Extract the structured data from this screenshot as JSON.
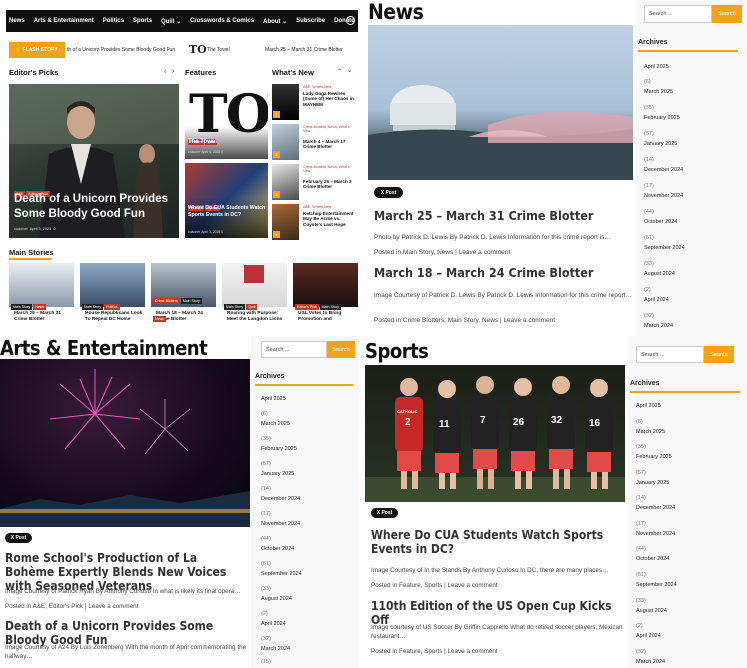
{
  "home": {
    "nav": [
      "News",
      "Arts & Entertainment",
      "Politics",
      "Sports",
      "Quill ⌄",
      "Crosswords & Comics",
      "About ⌄",
      "Subscribe",
      "Donate"
    ],
    "flash_label": "FLASH STORY",
    "ticker": [
      "th of a Unicorn Provides Some Bloody Good Fun",
      "The Towel",
      "March 25 – March 31 Crime Blotter"
    ],
    "editors_picks": {
      "heading": "Editor's Picks",
      "tags": [
        "A&E",
        "Editor's Pick"
      ],
      "title": "Death of a Unicorn Provides Some Bloody Good Fun",
      "author": "cuaoner",
      "date": "April 3, 2025",
      "comments": "0"
    },
    "features": {
      "heading": "Features",
      "items": [
        {
          "tags": [
            "Feature",
            "Quill"
          ],
          "title": "The Towel",
          "author": "cuaoner",
          "date": "April 4, 2025",
          "comments": "0"
        },
        {
          "tags": [
            "Feature",
            "Sports"
          ],
          "title": "Where Do CUA Students Watch Sports Events in DC?",
          "author": "cuaoner",
          "date": "April 3, 2025",
          "comments": "0"
        }
      ]
    },
    "whats_new": {
      "heading": "What's New",
      "items": [
        {
          "num": "1",
          "tags": "A&E, What's New",
          "title": "Lady Gaga Rewires (Some of) Her Chaos in MAYHEM"
        },
        {
          "num": "2",
          "tags": "Crime Blotters, News, What's New",
          "title": "March 4 – March 17 Crime Blotter"
        },
        {
          "num": "3",
          "tags": "Crime Blotters, News, What's New",
          "title": "February 25 – March 3 Crime Blotter"
        },
        {
          "num": "4",
          "tags": "A&E, What's New",
          "title": "Ketchup Entertainment May Be Acme vs. Coyote's Last Hope"
        }
      ]
    },
    "main_stories": {
      "heading": "Main Stories",
      "items": [
        {
          "tags": [
            "Main Story",
            "News"
          ],
          "title": "March 25 – March 31 Crime Blotter"
        },
        {
          "tags": [
            "Main Story",
            "Politics"
          ],
          "title": "House Republicans Look To Repeal DC Home"
        },
        {
          "tags": [
            "Crime Blotters",
            "Main Story",
            "News"
          ],
          "title": "March 18 – March 24 Crime Blotter"
        },
        {
          "tags": [
            "Main Story",
            "Quill"
          ],
          "title": "Roaring with Purpose: Meet the Langdon Lions"
        },
        {
          "tags": [
            "Editor's Pick",
            "Main Story"
          ],
          "title": "USL Votes to Bring Promotion and"
        }
      ]
    }
  },
  "sidebar": {
    "search_placeholder": "Search ...",
    "search_button": "Search",
    "archives_label": "Archives",
    "archives": [
      {
        "count": "",
        "month": "April 2025"
      },
      {
        "count": "(6)",
        "month": "March 2025"
      },
      {
        "count": "(35)",
        "month": "February 2025"
      },
      {
        "count": "(57)",
        "month": "January 2025"
      },
      {
        "count": "(14)",
        "month": "December 2024"
      },
      {
        "count": "(17)",
        "month": "November 2024"
      },
      {
        "count": "(44)",
        "month": "October 2024"
      },
      {
        "count": "(61)",
        "month": "September 2024"
      },
      {
        "count": "(33)",
        "month": "August 2024"
      },
      {
        "count": "(2)",
        "month": "April 2024"
      },
      {
        "count": "(32)",
        "month": "March 2024"
      },
      {
        "count": "(15)",
        "month": ""
      }
    ]
  },
  "news": {
    "heading": "News",
    "x_post": "X Post",
    "articles": [
      {
        "title": "March 25 – March 31 Crime Blotter",
        "excerpt": "Photo by Patrick D. Lewis By Patrick D. Lewis Information for this crime report is…",
        "meta": "Posted in Main Story, News | Leave a comment"
      },
      {
        "title": "March 18 – March 24 Crime Blotter",
        "excerpt": "Image Courtesy of Patrick D. Lewis By Patrick D. Lewis Information for this crime report…",
        "meta": "Posted in Crime Blotters, Main Story, News | Leave a comment"
      }
    ]
  },
  "arts": {
    "heading": "Arts & Entertainment",
    "x_post": "X Post",
    "articles": [
      {
        "title": "Rome School's Production of La Bohème Expertly Blends New Voices with Seasoned Veterans",
        "excerpt": "Image Courtesy of Patrick Ryan By Anthony Curioso In what is likely its final opera…",
        "meta": "Posted in A&E, Editor's Pick | Leave a comment"
      },
      {
        "title": "Death of a Unicorn Provides Some Bloody Good Fun",
        "excerpt": "Image Courtesy of A24 By Luis Zonenberg With the month of April commemorating the halfway…",
        "meta": ""
      }
    ]
  },
  "sports": {
    "heading": "Sports",
    "x_post": "X Post",
    "jersey_text": "CATHOLIC",
    "jersey_numbers": [
      "2",
      "11",
      "7",
      "26",
      "32",
      "16"
    ],
    "articles": [
      {
        "title": "Where Do CUA Students Watch Sports Events in DC?",
        "excerpt": "Image Courtesy of In the Stands By Anthony Curioso In DC, there are many places…",
        "meta": "Posted in Feature, Sports | Leave a comment"
      },
      {
        "title": "110th Edition of the US Open Cup Kicks Off",
        "excerpt": "Image courtesy of US Soccer By Griffin Cappiello What do retired soccer players, Mexican restaurant…",
        "meta": "Posted in Feature, Sports | Leave a comment"
      }
    ]
  },
  "colors": {
    "accent": "#f4a21a",
    "nav": "#111111",
    "tag_red": "#c0392b"
  }
}
